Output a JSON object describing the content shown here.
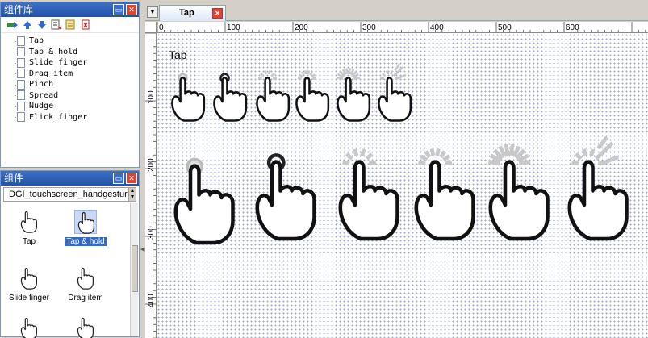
{
  "library_panel": {
    "title": "组件库",
    "items": [
      {
        "label": "Tap"
      },
      {
        "label": "Tap & hold"
      },
      {
        "label": "Slide finger"
      },
      {
        "label": "Drag item"
      },
      {
        "label": "Pinch"
      },
      {
        "label": "Spread"
      },
      {
        "label": "Nudge"
      },
      {
        "label": "Flick finger"
      }
    ],
    "toolbar_icons": [
      "add-library-icon",
      "move-up-icon",
      "move-down-icon",
      "edit-list-icon",
      "notepad-icon",
      "delete-icon"
    ]
  },
  "components_panel": {
    "title": "组件",
    "library_select": "DGI_touchscreen_handgestures",
    "items": [
      {
        "label": "Tap",
        "selected": false
      },
      {
        "label": "Tap & hold",
        "selected": true
      },
      {
        "label": "Slide finger",
        "selected": false
      },
      {
        "label": "Drag item",
        "selected": false
      },
      {
        "label": "",
        "selected": false
      },
      {
        "label": "",
        "selected": false
      }
    ]
  },
  "tabs": [
    {
      "label": "Tap"
    }
  ],
  "ruler": {
    "h_labels": [
      "0",
      "100",
      "200",
      "300",
      "400",
      "500",
      "600"
    ],
    "v_labels": [
      "100",
      "200",
      "300",
      "400"
    ]
  },
  "canvas": {
    "title": "Tap"
  },
  "colors": {
    "panel_title": "#2f5fba",
    "selection": "#316ac5",
    "close": "#d8462f",
    "grid_dot": "#9aa4d6"
  }
}
